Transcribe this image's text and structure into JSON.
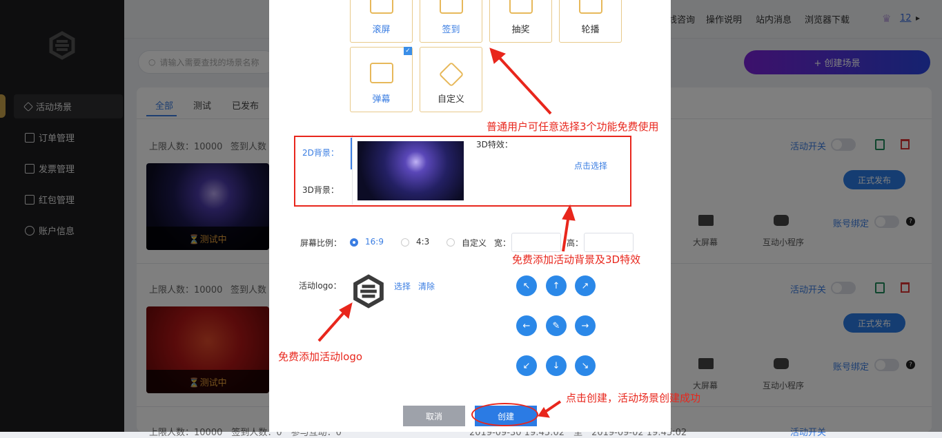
{
  "sidebar": {
    "items": [
      {
        "label": "活动场景"
      },
      {
        "label": "订单管理"
      },
      {
        "label": "发票管理"
      },
      {
        "label": "红包管理"
      },
      {
        "label": "账户信息"
      }
    ]
  },
  "topbar": {
    "links": [
      "线咨询",
      "操作说明",
      "站内消息",
      "浏览器下载"
    ],
    "level": "12",
    "arrow": "▸"
  },
  "search": {
    "placeholder": "请输入需要查找的场景名称"
  },
  "create_scene": {
    "label": "+ 创建场景"
  },
  "tabs": [
    "全部",
    "测试",
    "已发布"
  ],
  "rows": [
    {
      "limit": "上限人数：10000",
      "signin": "签到人数",
      "status": "⏳测试中"
    },
    {
      "limit": "上限人数：10000",
      "signin": "签到人数",
      "status": "⏳测试中"
    }
  ],
  "bottom_row": {
    "text": "上限人数：10000　签到人数：0　参与互动：0",
    "dates": "2019-09-30 19:45:02　至　2019-09-02 19:45:02",
    "toggle_label": "活动开关"
  },
  "row_actions": {
    "toggle_label": "活动开关",
    "publish": "正式发布",
    "device1": "大屏幕",
    "device2": "互动小程序",
    "bind": "账号绑定",
    "help": "?"
  },
  "modal": {
    "features_top": [
      "滚屏",
      "签到",
      "抽奖",
      "轮播"
    ],
    "features_bottom": [
      "弹幕",
      "自定义"
    ],
    "check": "✓",
    "bg_2d": "2D背景：",
    "bg_3d": "3D背景：",
    "effect_3d": "3D特效：",
    "pick": "点击选择",
    "ratio_label": "屏幕比例：",
    "ratio_169": "16:9",
    "ratio_43": "4:3",
    "ratio_custom": "自定义",
    "width_label": "宽：",
    "height_label": "高：",
    "logo_label": "活动logo：",
    "logo_select": "选择",
    "logo_clear": "清除",
    "dirs": [
      "↖",
      "↑",
      "↗",
      "←",
      "✎",
      "→",
      "↙",
      "↓",
      "↘"
    ],
    "cancel": "取消",
    "create": "创建"
  },
  "annotations": {
    "a1": "普通用户可任意选择3个功能免费使用",
    "a2": "免费添加活动背景及3D特效",
    "a3": "免费添加活动logo",
    "a4": "点击创建，活动场景创建成功"
  },
  "colors": {
    "accent": "#3a7de2",
    "annotation": "#e8261c",
    "gold": "#e7b85a"
  }
}
